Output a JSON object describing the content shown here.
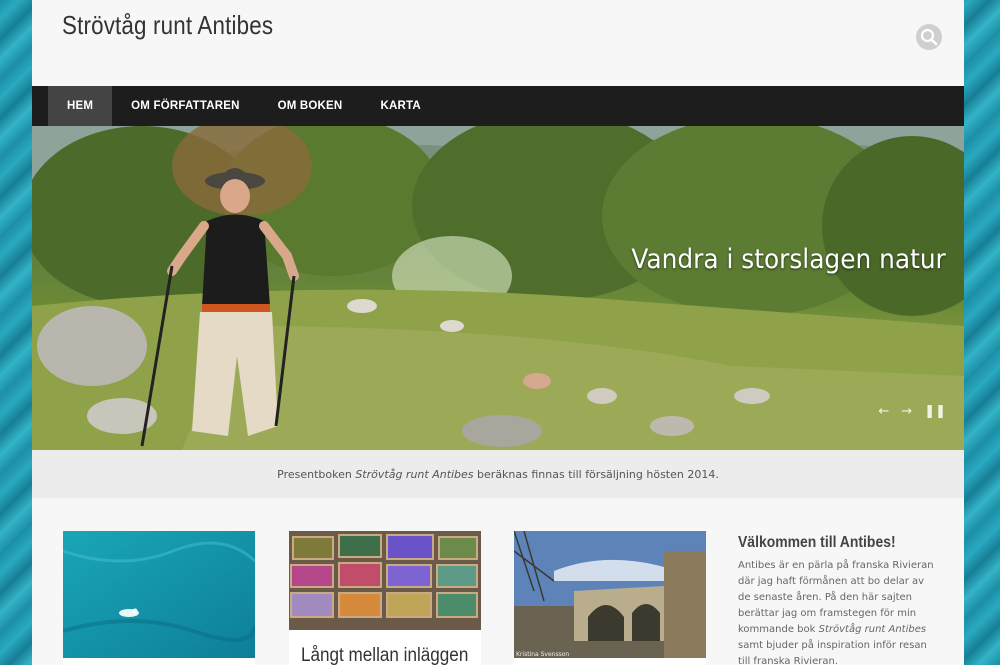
{
  "site": {
    "title": "Strövtåg runt Antibes"
  },
  "header": {
    "search_icon": "search-icon"
  },
  "nav": {
    "items": [
      {
        "label": "HEM",
        "active": true
      },
      {
        "label": "OM FÖRFATTAREN"
      },
      {
        "label": "OM BOKEN"
      },
      {
        "label": "KARTA"
      }
    ]
  },
  "hero": {
    "caption": "Vandra i storslagen natur",
    "prev_icon": "arrow-left-icon",
    "next_icon": "arrow-right-icon",
    "pause_icon": "pause-icon"
  },
  "announcement": {
    "prefix": "Presentboken ",
    "book": "Strövtåg runt Antibes",
    "suffix": " beräknas finnas till försäljning hösten 2014."
  },
  "cards": [
    {
      "image": "sea-swimmer-photo"
    },
    {
      "image": "paint-boxes-photo",
      "title": "Långt mellan inläggen"
    },
    {
      "image": "stone-bridge-photo",
      "credit": "Kristina Svensson"
    }
  ],
  "sidebar": {
    "title": "Välkommen till Antibes!",
    "line1": "Antibes är en pärla på franska Rivieran",
    "line2": "där jag haft förmånen att bo delar av",
    "line3": "de senaste åren. På den här sajten",
    "line4": "berättar jag om framstegen för min",
    "line5_prefix": "kommande bok ",
    "line5_book": "Strövtåg runt Antibes",
    "line6": "samt bjuder på inspiration inför resan",
    "line7": "till franska Rivieran."
  },
  "colors": {
    "nav_bg": "#1d1d1d",
    "nav_active": "#444444",
    "page_bg": "#f7f7f7",
    "water": "#2aa9c0"
  }
}
